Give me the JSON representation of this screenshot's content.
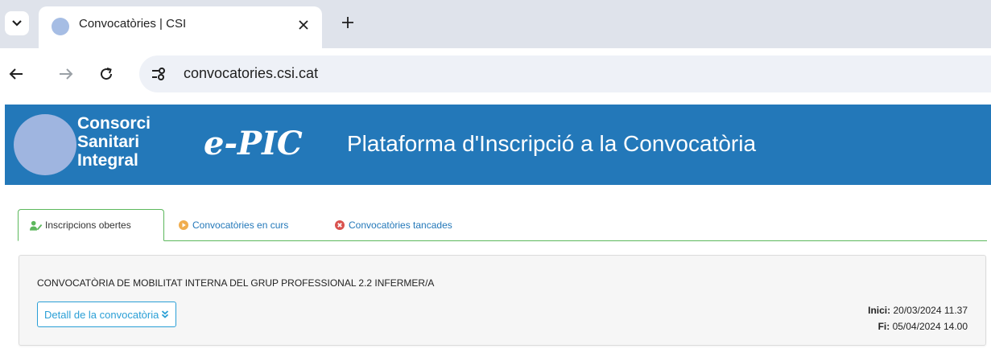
{
  "browser": {
    "tab_title": "Convocatòries | CSI",
    "url": "convocatories.csi.cat",
    "icons": [
      "tab-dropdown-icon",
      "favicon-icon",
      "close-icon",
      "new-tab-icon",
      "back-arrow-icon",
      "forward-arrow-icon",
      "reload-icon",
      "site-settings-icon"
    ]
  },
  "header": {
    "org_line1": "Consorci",
    "org_line2": "Sanitari",
    "org_line3": "Integral",
    "epic_logo": "e-PIC",
    "platform_title": "Plataforma d'Inscripció a la Convocatòria",
    "background_color": "#2378b9"
  },
  "tabs": [
    {
      "label": "Inscripcions obertes",
      "icon": "user-edit-icon",
      "active": true
    },
    {
      "label": "Convocatòries en curs",
      "icon": "play-circle-icon",
      "active": false
    },
    {
      "label": "Convocatòries tancades",
      "icon": "times-circle-icon",
      "active": false
    }
  ],
  "convocatoria": {
    "title": "CONVOCATÒRIA DE MOBILITAT INTERNA DEL GRUP PROFESSIONAL 2.2 INFERMER/A",
    "detail_button": "Detall de la convocatòria",
    "start_label": "Inici:",
    "start_value": "20/03/2024 11.37",
    "end_label": "Fi:",
    "end_value": "05/04/2024 14.00"
  },
  "colors": {
    "accent": "#2378b9",
    "tab_border": "#5cb85c",
    "link": "#2378b9",
    "button": "#2a9fd6",
    "play_icon": "#f0ad4e",
    "close_icon": "#d9534f"
  }
}
